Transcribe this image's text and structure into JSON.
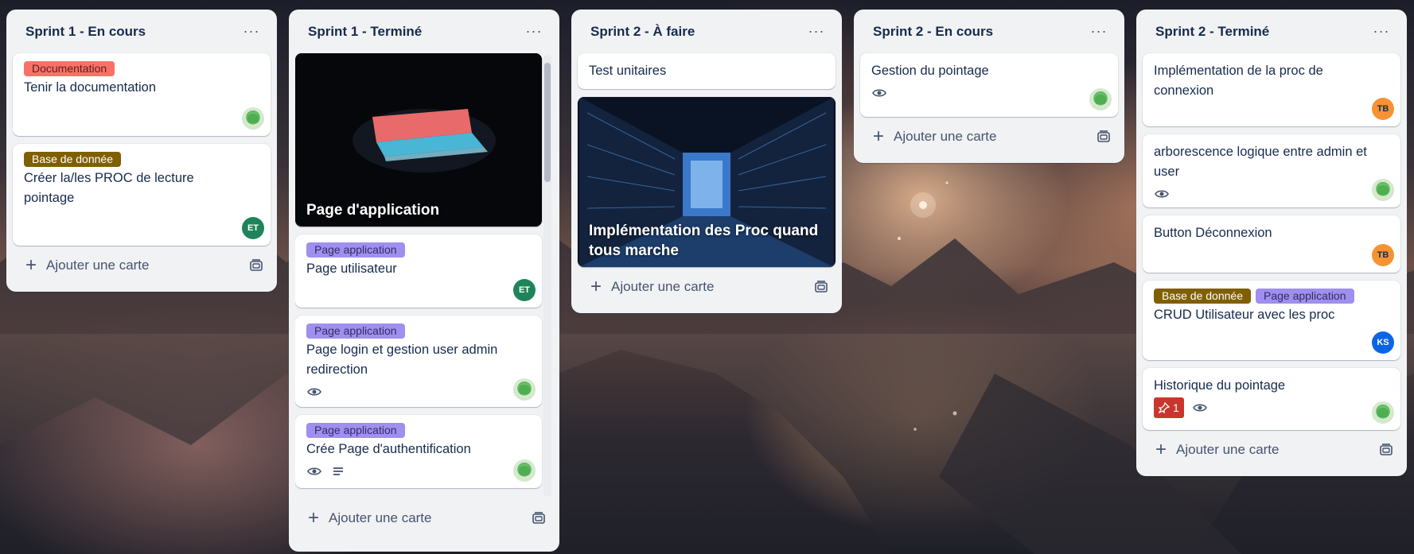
{
  "board": {
    "add_card_label": "Ajouter une carte",
    "list_menu_icon": "ellipsis-icon",
    "lists": [
      {
        "title": "Sprint 1 - En cours",
        "cards": [
          {
            "labels": [
              "Documentation"
            ],
            "title": "Tenir la documentation",
            "member": "avatar-image"
          },
          {
            "labels": [
              "Base de donnée"
            ],
            "title": "Créer la/les PROC de lecture pointage",
            "member": "ET"
          }
        ]
      },
      {
        "title": "Sprint 1 - Terminé",
        "cards": [
          {
            "cover_title": "Page d'application"
          },
          {
            "labels": [
              "Page application"
            ],
            "title": "Page utilisateur",
            "member": "ET"
          },
          {
            "labels": [
              "Page application"
            ],
            "title": "Page login et gestion user admin redirection",
            "badges": [
              "eye-icon"
            ],
            "member": "avatar-image"
          },
          {
            "labels": [
              "Page application"
            ],
            "title": "Crée Page d'authentification",
            "badges": [
              "eye-icon",
              "description-icon"
            ],
            "member": "avatar-image"
          }
        ]
      },
      {
        "title": "Sprint 2 - À faire",
        "cards": [
          {
            "title": "Test unitaires"
          },
          {
            "cover_title": "Implémentation des Proc quand tous marche"
          }
        ]
      },
      {
        "title": "Sprint 2 - En cours",
        "cards": [
          {
            "title": "Gestion du pointage",
            "badges": [
              "eye-icon"
            ],
            "member": "avatar-image"
          }
        ]
      },
      {
        "title": "Sprint 2 - Terminé",
        "cards": [
          {
            "title": "Implémentation de la proc de connexion",
            "member": "TB"
          },
          {
            "title": "arborescence logique entre admin et user",
            "badges": [
              "eye-icon"
            ],
            "member": "avatar-image"
          },
          {
            "title": "Button Déconnexion",
            "member": "TB"
          },
          {
            "labels": [
              "Base de donnée",
              "Page application"
            ],
            "title": "CRUD Utilisateur avec les proc",
            "member": "KS"
          },
          {
            "title": "Historique du pointage",
            "overdue_count": "1",
            "badges": [
              "eye-icon"
            ],
            "member": "avatar-image"
          }
        ]
      }
    ]
  },
  "colors": {
    "list_bg": "#f1f2f4",
    "label_documentation": "#f87168",
    "label_base_de_donnee": "#7f5f01",
    "label_page_application": "#9f8fef",
    "overdue_badge": "#c9372c"
  }
}
